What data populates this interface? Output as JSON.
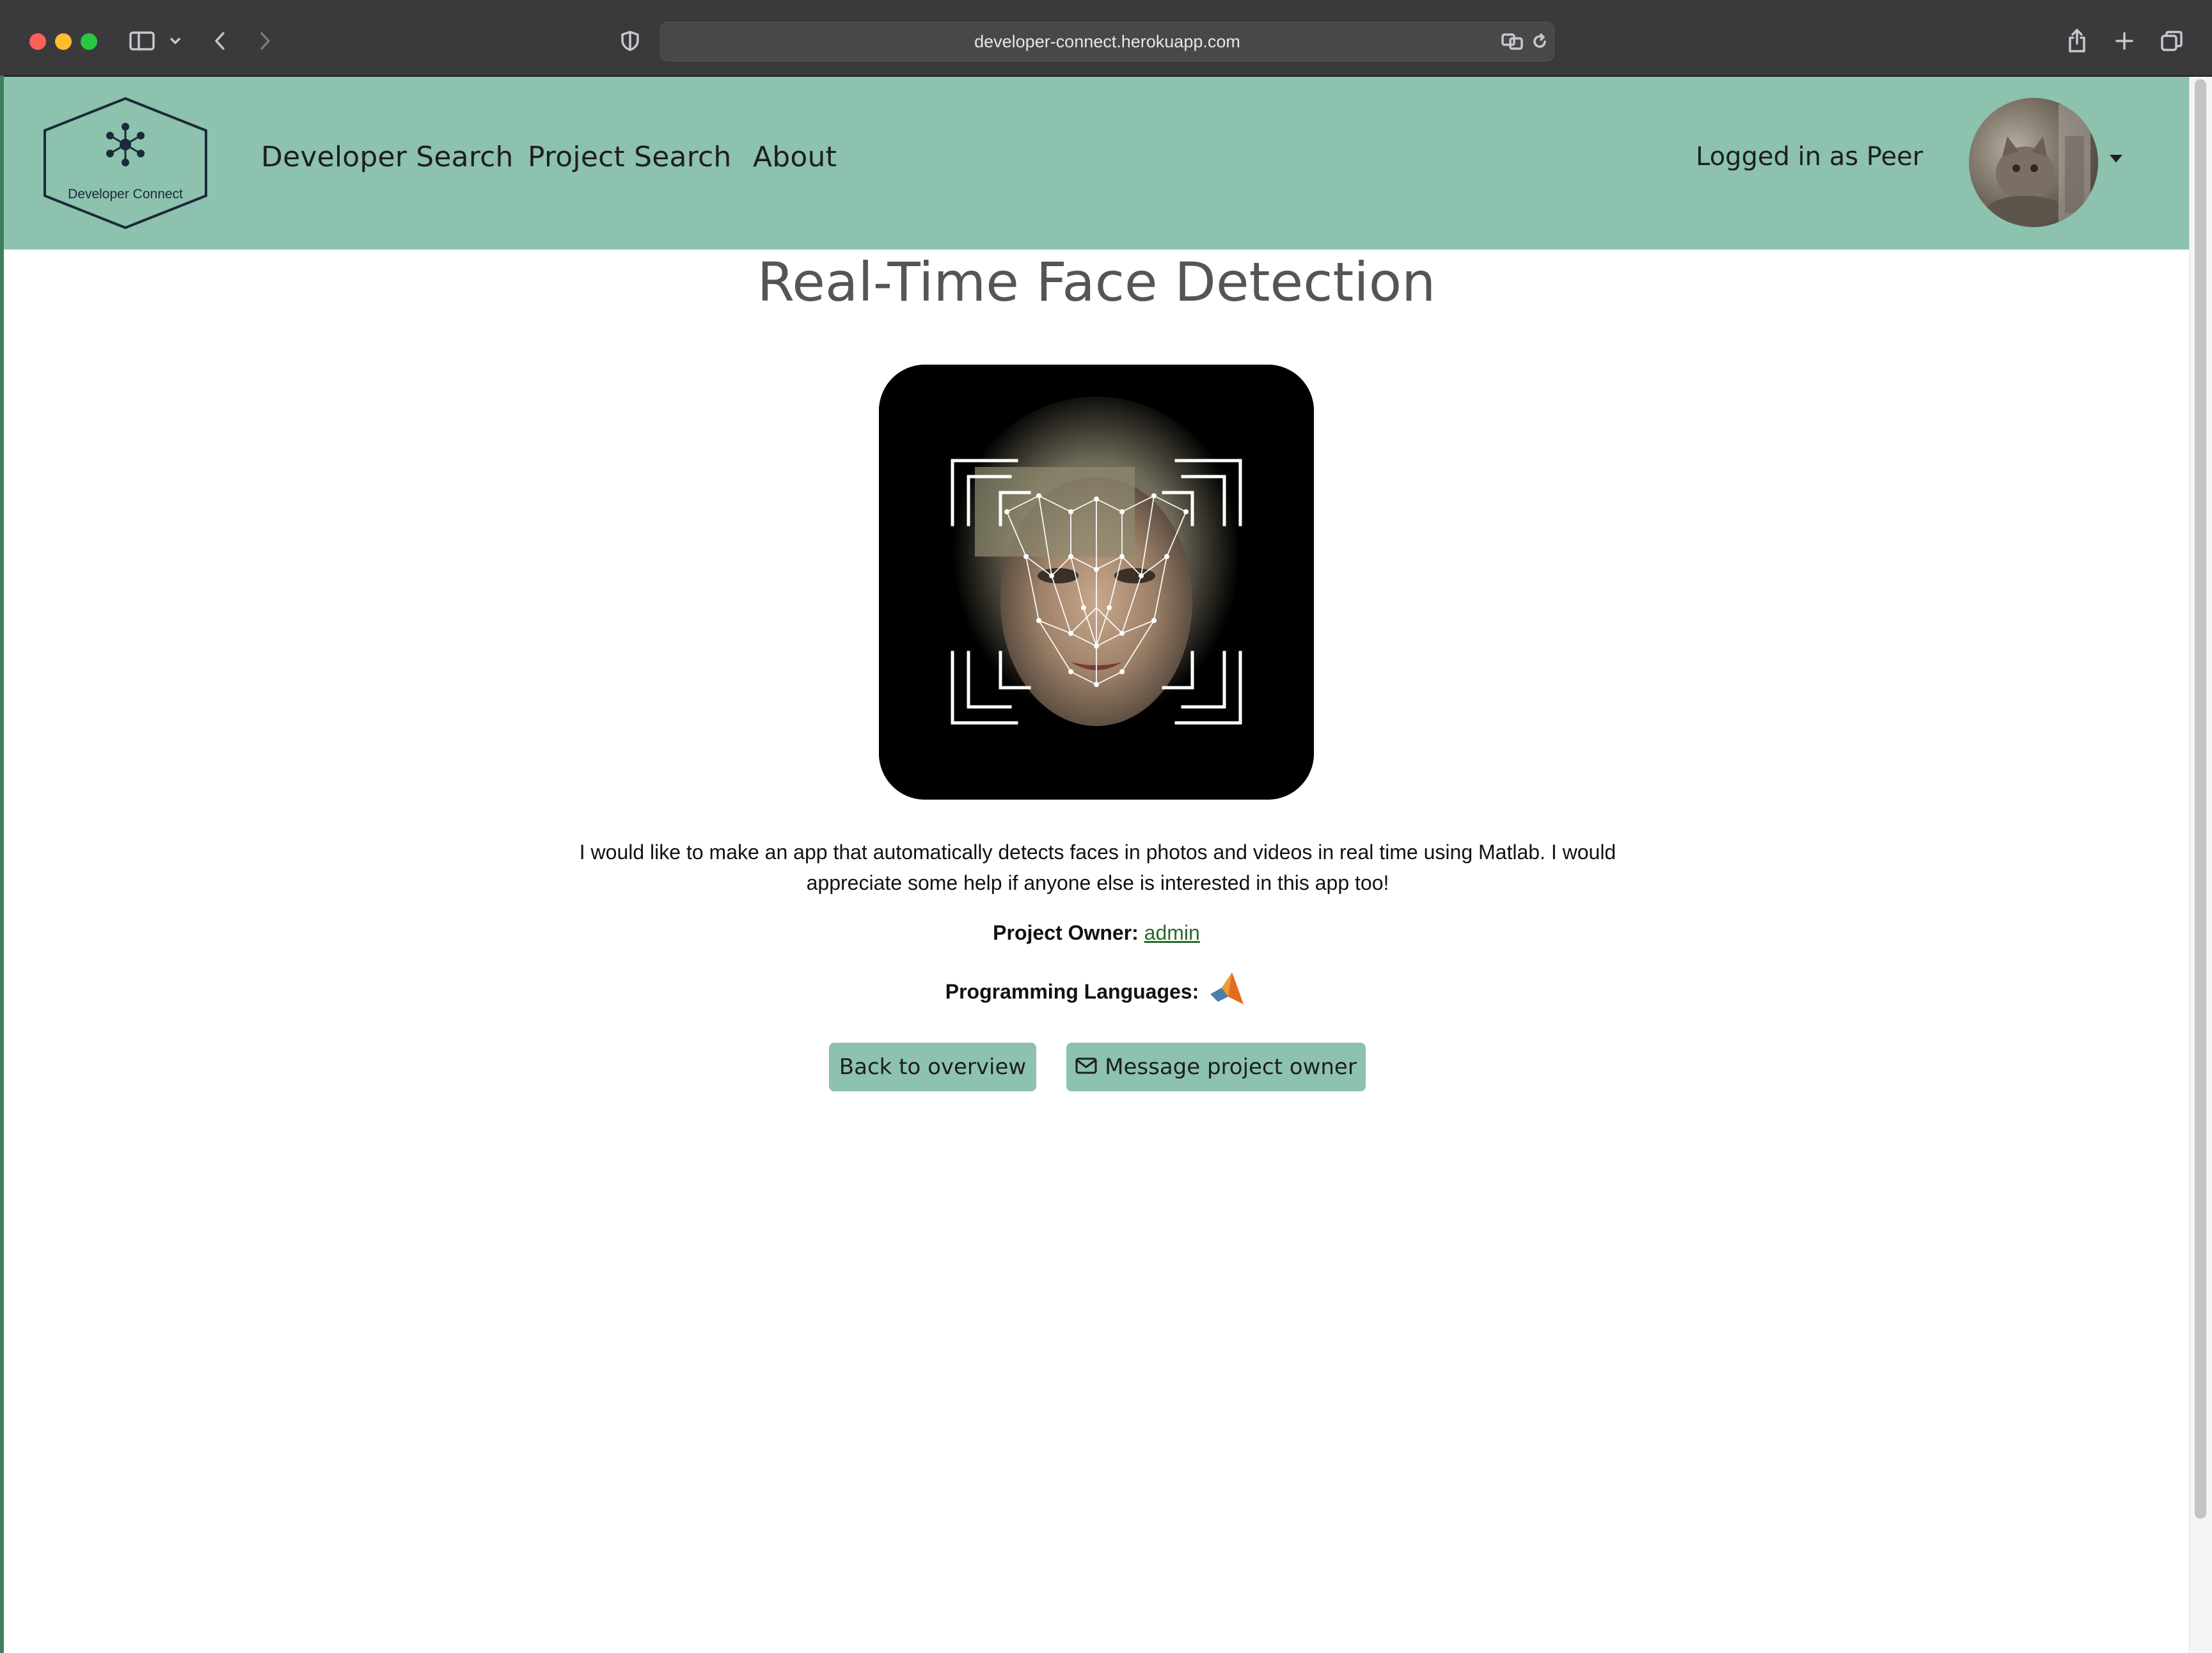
{
  "browser": {
    "url": "developer-connect.herokuapp.com"
  },
  "site": {
    "logo_text": "Developer Connect",
    "nav": [
      {
        "label": "Developer Search"
      },
      {
        "label": "Project Search"
      },
      {
        "label": "About"
      }
    ],
    "user_status": "Logged in as Peer",
    "brand_color": "#8cc2ae"
  },
  "project": {
    "title": "Real-Time Face Detection",
    "description": "I would like to make an app that automatically detects faces in photos and videos in real time using Matlab. I would appreciate some help if anyone else is interested in this app too!",
    "owner_label": "Project Owner:",
    "owner_name": "admin",
    "languages_label": "Programming Languages:",
    "languages": [
      {
        "icon": "matlab-icon"
      }
    ]
  },
  "actions": {
    "back_label": "Back to overview",
    "message_label": "Message project owner"
  }
}
